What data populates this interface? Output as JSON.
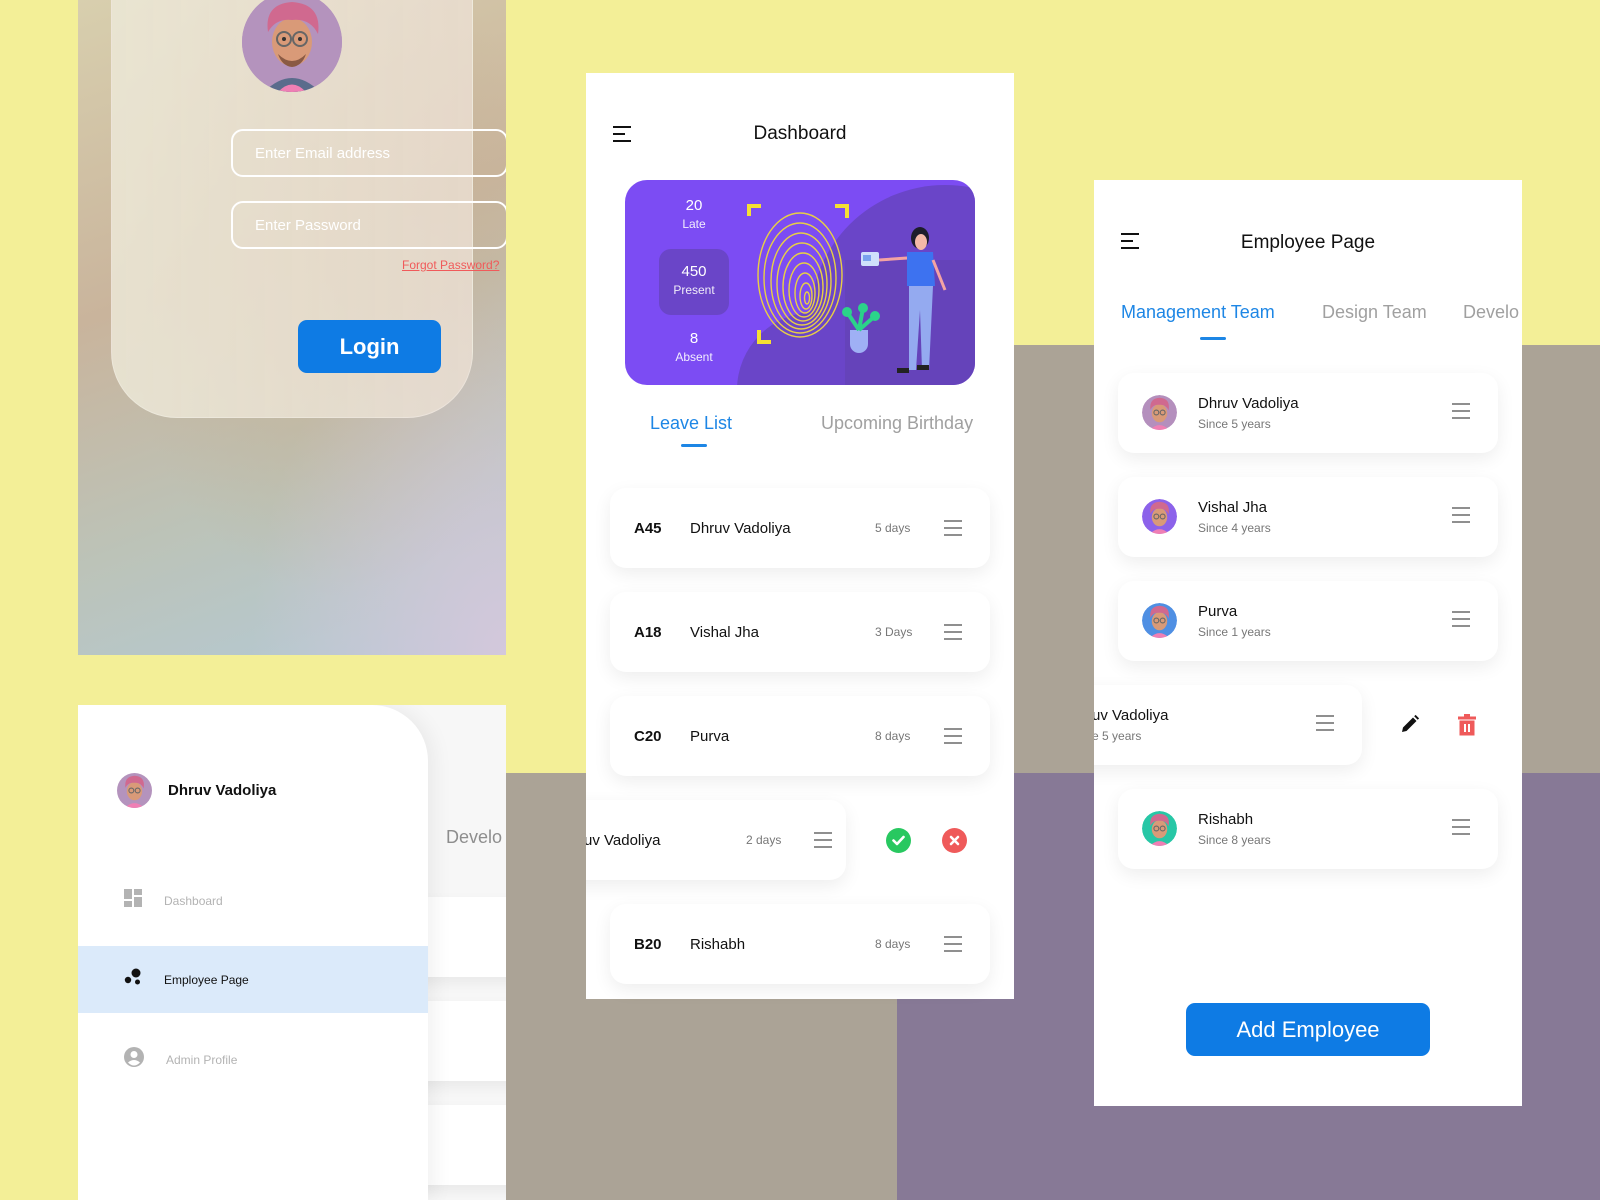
{
  "login": {
    "email_placeholder": "Enter Email address",
    "password_placeholder": "Enter Password",
    "forgot_password": "Forgot Password?",
    "login_button": "Login"
  },
  "sidebar": {
    "username": "Dhruv Vadoliya",
    "behind_tab": "Develo",
    "items": [
      {
        "label": "Dashboard",
        "icon": "dashboard-icon",
        "active": false
      },
      {
        "label": "Employee Page",
        "icon": "bubbles-icon",
        "active": true
      },
      {
        "label": "Admin  Profile",
        "icon": "account-circle-icon",
        "active": false
      }
    ]
  },
  "dashboard": {
    "title": "Dashboard",
    "stats": {
      "late": {
        "value": "20",
        "label": "Late"
      },
      "present": {
        "value": "450",
        "label": "Present"
      },
      "absent": {
        "value": "8",
        "label": "Absent"
      }
    },
    "tabs": {
      "leave_list": "Leave List",
      "upcoming_birthday": "Upcoming Birthday"
    },
    "leave_list": [
      {
        "code": "A45",
        "name": "Dhruv Vadoliya",
        "days": "5 days"
      },
      {
        "code": "A18",
        "name": "Vishal Jha",
        "days": "3 Days"
      },
      {
        "code": "C20",
        "name": "Purva",
        "days": "8 days"
      },
      {
        "code": "",
        "name": "uv Vadoliya",
        "days": "2 days"
      },
      {
        "code": "B20",
        "name": "Rishabh",
        "days": "8 days"
      }
    ]
  },
  "employee_page": {
    "title": "Employee Page",
    "tabs": [
      "Management Team",
      "Design Team",
      "Develo"
    ],
    "employees": [
      {
        "name": "Dhruv Vadoliya",
        "since": "Since 5 years",
        "avatar_bg": "#b48fbd"
      },
      {
        "name": "Vishal Jha",
        "since": "Since 4 years",
        "avatar_bg": "#8c62ea"
      },
      {
        "name": "Purva",
        "since": "Since 1 years",
        "avatar_bg": "#4f8fe3"
      },
      {
        "name": "uv Vadoliya",
        "since": "e 5 years",
        "avatar_bg": ""
      },
      {
        "name": "Rishabh",
        "since": "Since 8 years",
        "avatar_bg": "#27c7a6"
      }
    ],
    "add_button": "Add Employee"
  },
  "colors": {
    "accent_blue": "#0e7be4",
    "tab_blue": "#1d86e5",
    "banner_purple": "#7c4cf3",
    "approve_green": "#28c860",
    "reject_red": "#ef5a5a",
    "bg_yellow": "#f3ef97",
    "bg_taupe": "#aba396",
    "bg_purple": "#877996"
  }
}
